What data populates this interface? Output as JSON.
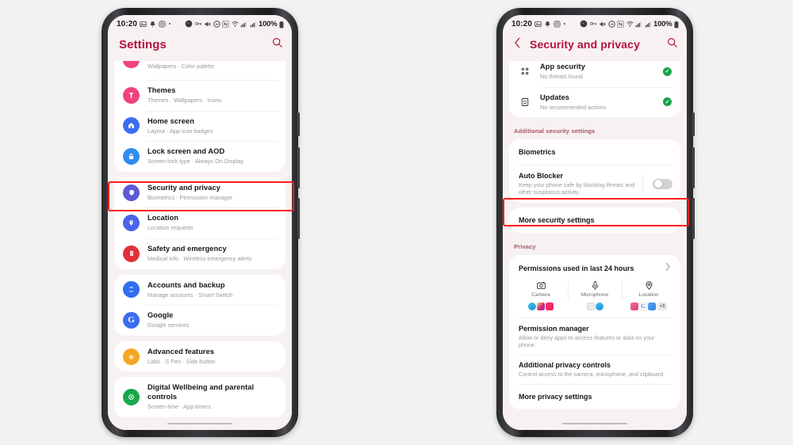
{
  "status_bar": {
    "time": "10:20",
    "battery": "100%",
    "left_icons": [
      "gallery-icon",
      "bell-icon",
      "instagram-icon",
      "dot-icon"
    ],
    "right_icons": [
      "recording-dot-icon",
      "vpn-key-icon",
      "mute-icon",
      "dnd-icon",
      "nfc-icon",
      "wifi-calling-icon",
      "signal-1-icon",
      "signal-2-icon"
    ]
  },
  "left_phone": {
    "header": {
      "title": "Settings",
      "search_icon": "search-icon"
    },
    "groups": [
      {
        "items": [
          {
            "icon": "wallpaper-icon",
            "icon_color": "#f0447f",
            "title": "",
            "subtitle": "Wallpapers  ·  Color palette",
            "partial": true
          },
          {
            "icon": "themes-icon",
            "icon_color": "#f0447f",
            "title": "Themes",
            "subtitle": "Themes  ·  Wallpapers  ·  Icons"
          },
          {
            "icon": "home-icon",
            "icon_color": "#3b6ef0",
            "title": "Home screen",
            "subtitle": "Layout  ·  App icon badges"
          },
          {
            "icon": "lock-icon",
            "icon_color": "#2f8ef0",
            "title": "Lock screen and AOD",
            "subtitle": "Screen lock type  ·  Always On Display"
          }
        ]
      },
      {
        "items": [
          {
            "icon": "shield-icon",
            "icon_color": "#5b5bd6",
            "title": "Security and privacy",
            "subtitle": "Biometrics  ·  Permission manager",
            "highlighted": true
          },
          {
            "icon": "location-pin-icon",
            "icon_color": "#4b63e8",
            "title": "Location",
            "subtitle": "Location requests"
          },
          {
            "icon": "safety-icon",
            "icon_color": "#e0313a",
            "title": "Safety and emergency",
            "subtitle": "Medical info  ·  Wireless emergency alerts"
          }
        ]
      },
      {
        "items": [
          {
            "icon": "sync-icon",
            "icon_color": "#2f6ef0",
            "title": "Accounts and backup",
            "subtitle": "Manage accounts  ·  Smart Switch"
          },
          {
            "icon": "google-icon",
            "icon_color": "#3b6ef0",
            "title": "Google",
            "subtitle": "Google services"
          }
        ]
      },
      {
        "items": [
          {
            "icon": "advanced-features-icon",
            "icon_color": "#f5a623",
            "title": "Advanced features",
            "subtitle": "Labs  ·  S Pen  ·  Side button"
          }
        ]
      },
      {
        "items": [
          {
            "icon": "digital-wellbeing-icon",
            "icon_color": "#19a84c",
            "title": "Digital Wellbeing and parental controls",
            "subtitle": "Screen time  ·  App timers"
          }
        ]
      }
    ]
  },
  "right_phone": {
    "header": {
      "back_icon": "back-chevron-icon",
      "title": "Security and privacy",
      "search_icon": "search-icon"
    },
    "status_items": [
      {
        "icon": "app-security-icon",
        "title": "App security",
        "subtitle": "No threats found",
        "status": "ok",
        "status_icon": "check-circle-icon"
      },
      {
        "icon": "updates-icon",
        "title": "Updates",
        "subtitle": "No recommended actions",
        "status": "ok",
        "status_icon": "check-circle-icon"
      }
    ],
    "additional_security_header": "Additional security settings",
    "security_items": [
      {
        "title": "Biometrics",
        "subtitle": ""
      },
      {
        "title": "Auto Blocker",
        "subtitle": "Keep your phone safe by blocking threats and other suspicious activity.",
        "toggle": "off"
      },
      {
        "title": "More security settings",
        "subtitle": "",
        "highlighted": true
      }
    ],
    "privacy_header": "Privacy",
    "permissions": {
      "title": "Permissions used in last 24 hours",
      "chevron_icon": "chevron-right-icon",
      "columns": [
        {
          "icon": "camera-icon",
          "label": "Camera",
          "apps": [
            {
              "name": "telegram-app-icon",
              "color": "#2aabee",
              "shape": "round"
            },
            {
              "name": "instagram-app-icon",
              "color": "#d6249f",
              "shape": "square"
            },
            {
              "name": "youtube-app-icon",
              "color": "#e8245a",
              "shape": "square"
            }
          ],
          "extra": ""
        },
        {
          "icon": "microphone-icon",
          "label": "Microphone",
          "apps": [
            {
              "name": "voice-recorder-app-icon",
              "color": "#e2e2e2",
              "shape": "square"
            },
            {
              "name": "telegram-app-icon",
              "color": "#2aabee",
              "shape": "round"
            }
          ],
          "extra": ""
        },
        {
          "icon": "location-icon",
          "label": "Location",
          "apps": [
            {
              "name": "maps-app-icon",
              "color": "#ef5ba1",
              "shape": "square"
            },
            {
              "name": "google-app-icon",
              "color": "#ffffff",
              "shape": "square"
            },
            {
              "name": "chrome-app-icon",
              "color": "#4a90e2",
              "shape": "square"
            }
          ],
          "extra": "+3"
        }
      ]
    },
    "privacy_items": [
      {
        "title": "Permission manager",
        "subtitle": "Allow or deny apps to access features or data on your phone."
      },
      {
        "title": "Additional privacy controls",
        "subtitle": "Control access to the camera, microphone, and clipboard."
      },
      {
        "title": "More privacy settings",
        "subtitle": ""
      }
    ]
  },
  "colors": {
    "accent": "#b5123e",
    "highlight": "#ff1f1f",
    "ok_green": "#16a34a",
    "section_header": "#a9566b",
    "screen_bg": "#f7f1f1"
  }
}
